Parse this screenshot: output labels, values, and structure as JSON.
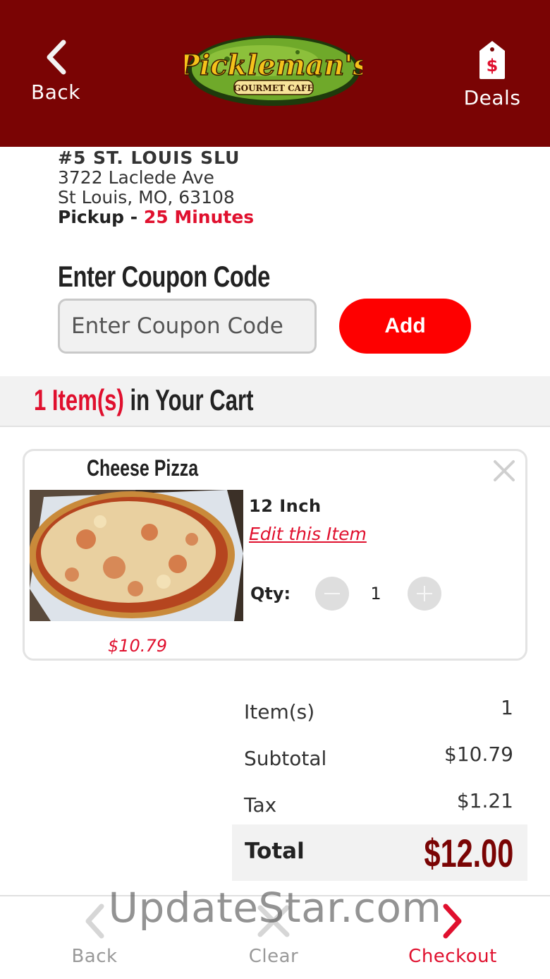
{
  "header": {
    "back_label": "Back",
    "deals_label": "Deals",
    "logo_text": "Pickleman's",
    "logo_subtext": "GOURMET CAFE",
    "bg_color": "#7a0404"
  },
  "store": {
    "name": "#5 ST. LOUIS SLU",
    "address_line1": "3722 Laclede Ave",
    "address_line2": "St Louis, MO, 63108",
    "pickup_label": "Pickup - ",
    "pickup_time": "25 Minutes"
  },
  "coupon": {
    "title": "Enter Coupon Code",
    "placeholder": "Enter Coupon Code",
    "add_label": "Add"
  },
  "cart": {
    "count_text": "1 Item(s)",
    "suffix_text": " in Your Cart",
    "items": [
      {
        "name": "Cheese Pizza",
        "size": "12 Inch",
        "edit_label": "Edit this Item",
        "qty_label": "Qty:",
        "qty": "1",
        "price": "$10.79"
      }
    ]
  },
  "summary": {
    "items_label": "Item(s)",
    "items_value": "1",
    "subtotal_label": "Subtotal",
    "subtotal_value": "$10.79",
    "tax_label": "Tax",
    "tax_value": "$1.21",
    "total_label": "Total",
    "total_value": "$12.00"
  },
  "bottom_nav": {
    "back_label": "Back",
    "clear_label": "Clear",
    "checkout_label": "Checkout"
  },
  "watermark": "UpdateStar.com",
  "colors": {
    "accent_red": "#e0102e",
    "button_red": "#fe0000",
    "dark_red": "#7a0404"
  }
}
